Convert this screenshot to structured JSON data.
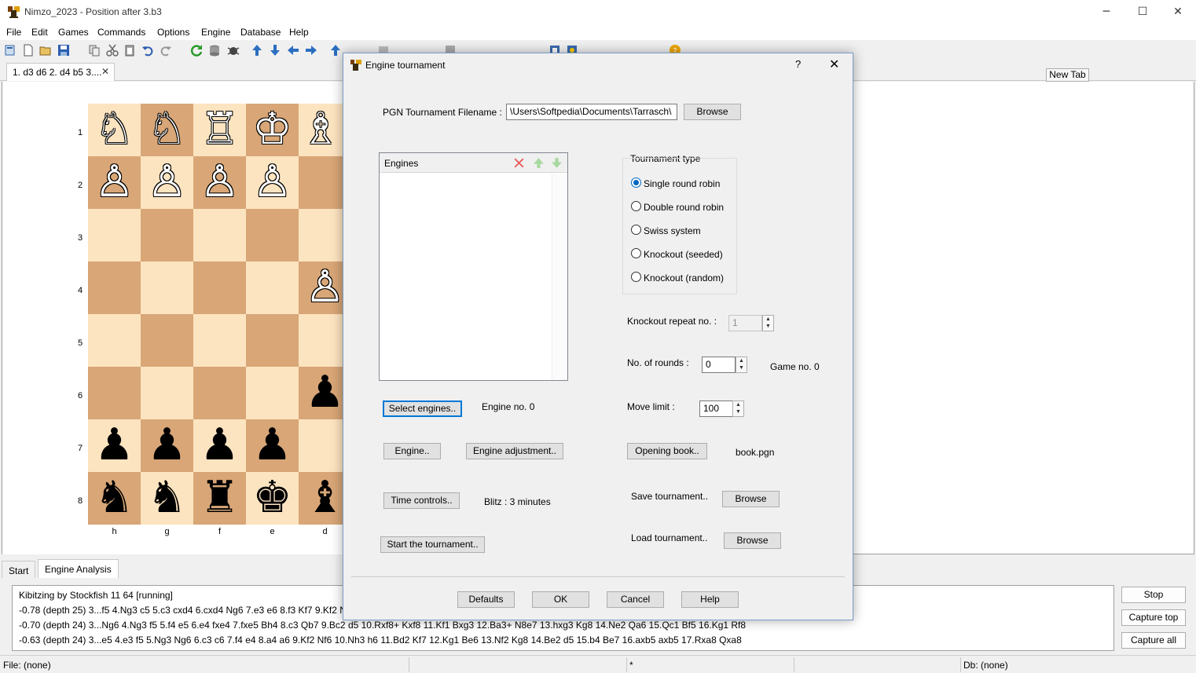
{
  "window": {
    "title": "Nimzo_2023  -  Position after 3.b3"
  },
  "menu": [
    "File",
    "Edit",
    "Games",
    "Commands",
    "Options",
    "Engine",
    "Database",
    "Help"
  ],
  "tabs": {
    "game_tab": "1. d3 d6 2. d4 b5 3....",
    "close": "✕",
    "new_tab": "New Tab"
  },
  "board": {
    "ranks": [
      "1",
      "2",
      "3",
      "4",
      "5",
      "6",
      "7",
      "8"
    ],
    "files": [
      "h",
      "g",
      "f",
      "e",
      "d"
    ],
    "pieces": {
      "r1": [
        "♘",
        "♘",
        "♖",
        "♔",
        "♗"
      ],
      "r2": [
        "♙",
        "♙",
        "♙",
        "♙",
        ""
      ],
      "r4": [
        "",
        "",
        "",
        "",
        "♙"
      ],
      "r6": [
        "",
        "",
        "",
        "",
        "♟"
      ],
      "r7": [
        "♟",
        "♟",
        "♟",
        "♟",
        ""
      ],
      "r8": [
        "♞",
        "♞",
        "♜",
        "♚",
        "♝"
      ]
    }
  },
  "bottom_tabs": {
    "start": "Start",
    "analysis": "Engine Analysis"
  },
  "analysis": {
    "lines": [
      "Kibitzing by Stockfish 11 64 [running]",
      "-0.78 (depth 25) 3...f5 4.Ng3 c5 5.c3 cxd4 6.cxd4 Ng6 7.e3 e6 8.f3 Kf7 9.Kf2 Nf6 10.",
      "-0.70 (depth 24) 3...Ng6 4.Ng3 f5 5.f4 e5 6.e4 fxe4 7.fxe5 Bh4 8.c3 Qb7 9.Bc2 d5 10.Rxf8+ Kxf8 11.Kf1 Bxg3 12.Ba3+ N8e7 13.hxg3 Kg8 14.Ne2 Qa6 15.Qc1 Bf5 16.Kg1 Rf8",
      "-0.63 (depth 24) 3...e5 4.e3 f5 5.Ng3 Ng6 6.c3 c6 7.f4 e4 8.a4 a6 9.Kf2 Nf6 10.Nh3 h6 11.Bd2 Kf7 12.Kg1 Be6 13.Nf2 Kg8 14.Be2 d5 15.b4 Be7 16.axb5 axb5 17.Rxa8 Qxa8"
    ],
    "stop": "Stop",
    "capture_top": "Capture top",
    "capture_all": "Capture all"
  },
  "status": {
    "file": "File: (none)",
    "star": "*",
    "db": "Db: (none)"
  },
  "dialog": {
    "title": "Engine tournament",
    "help_q": "?",
    "close": "✕",
    "pgn_label": "PGN Tournament Filename :",
    "pgn_value": "\\Users\\Softpedia\\Documents\\Tarrasch\\",
    "browse": "Browse",
    "engines_header": "Engines",
    "tournament_type_label": "Tournament type",
    "tournament_types": [
      "Single round robin",
      "Double round robin",
      "Swiss system",
      "Knockout (seeded)",
      "Knockout (random)"
    ],
    "selected_type": "Single round robin",
    "ko_repeat_label": "Knockout repeat no. :",
    "ko_repeat_value": "1",
    "rounds_label": "No. of rounds :",
    "rounds_value": "0",
    "game_no": "Game no.  0",
    "select_engines": "Select engines..",
    "engine_no": "Engine no.  0",
    "move_limit_label": "Move limit :",
    "move_limit_value": "100",
    "engine_btn": "Engine..",
    "engine_adjust": "Engine adjustment..",
    "opening_book": "Opening book..",
    "book_file": "book.pgn",
    "time_controls": "Time controls..",
    "blitz": "Blitz :  3 minutes",
    "save_tournament": "Save tournament..",
    "save_browse": "Browse",
    "start_tournament": "Start the tournament..",
    "load_tournament": "Load tournament..",
    "load_browse": "Browse",
    "defaults": "Defaults",
    "ok": "OK",
    "cancel": "Cancel",
    "help": "Help"
  },
  "colors": {
    "light_square": "#fde4c0",
    "dark_square": "#d8a677",
    "focus": "#0078d7"
  }
}
